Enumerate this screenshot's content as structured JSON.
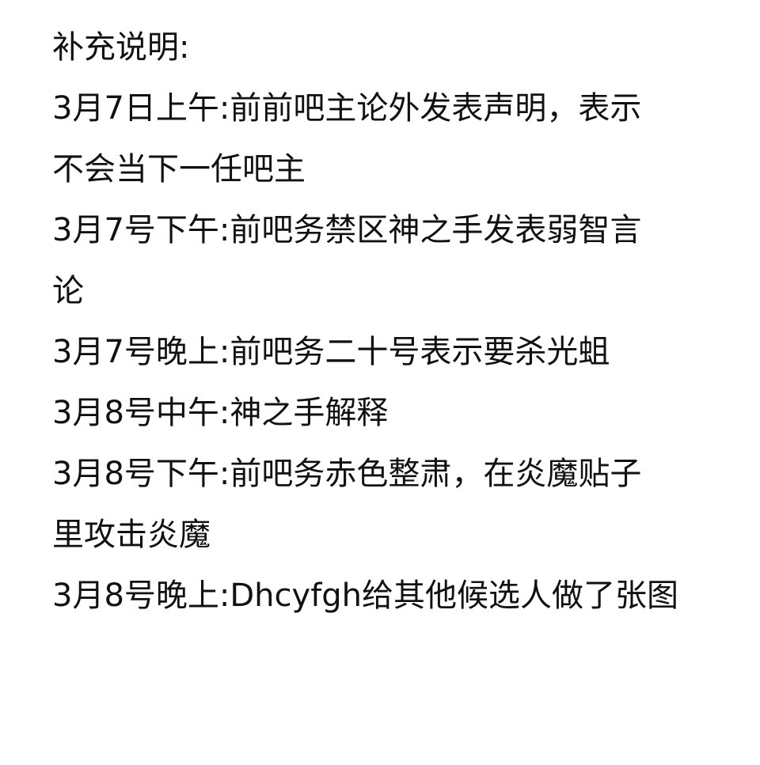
{
  "note": {
    "heading": "补充说明:",
    "lines": [
      "3月7日上午:前前吧主论外发表声明，表示",
      "不会当下一任吧主",
      "3月7号下午:前吧务禁区神之手发表弱智言",
      "论",
      "3月7号晚上:前吧务二十号表示要杀光蛆",
      "3月8号中午:神之手解释",
      "3月8号下午:前吧务赤色整肃，在炎魔贴子",
      "里攻击炎魔",
      "3月8号晚上:Dhcyfgh给其他候选人做了张图"
    ]
  }
}
